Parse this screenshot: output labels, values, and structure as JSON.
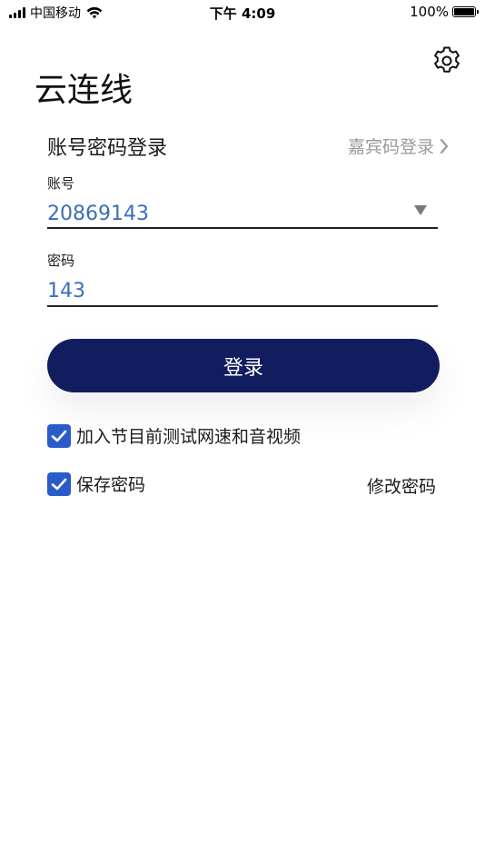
{
  "status_bar": {
    "carrier": "中国移动",
    "time": "下午 4:09",
    "battery_percent": "100%",
    "battery_level": 1.0,
    "signal_bars": 4
  },
  "app": {
    "title": "云连线"
  },
  "login": {
    "mode_title": "账号密码登录",
    "guest_login_link": "嘉宾码登录",
    "account": {
      "label": "账号",
      "value": "20869143"
    },
    "password": {
      "label": "密码",
      "value": "143"
    },
    "submit_label": "登录"
  },
  "options": {
    "test_network": {
      "label": "加入节目前测试网速和音视频",
      "checked": true
    },
    "save_password": {
      "label": "保存密码",
      "checked": true
    },
    "change_password_link": "修改密码"
  },
  "colors": {
    "primary_button": "#111d5e",
    "checkbox": "#2a5cc9",
    "input_text": "#3a6fb8",
    "secondary_text": "#9a9a9a"
  },
  "icons": {
    "settings": "gear-icon",
    "guest_arrow": "chevron-right-icon",
    "account_dropdown": "triangle-down-icon",
    "checkbox": "checkmark-icon"
  }
}
